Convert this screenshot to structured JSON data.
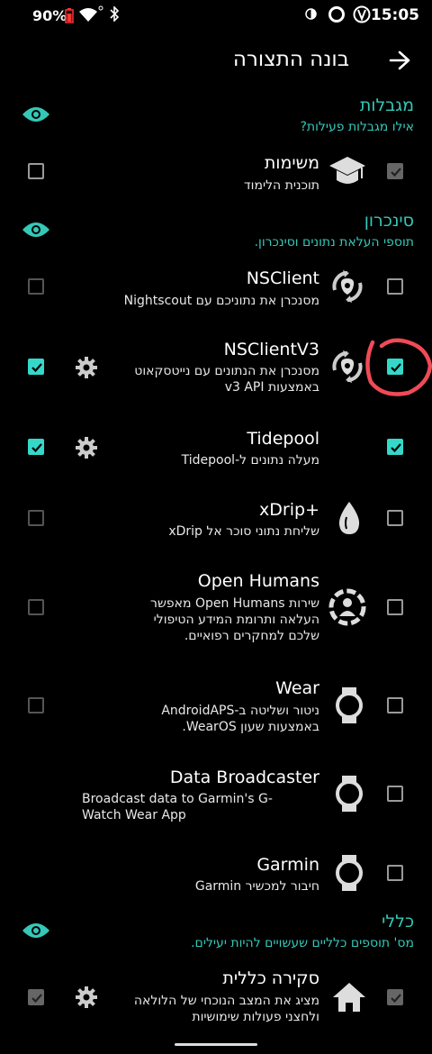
{
  "status": {
    "battery": "90%",
    "time": "15:05"
  },
  "appbar": {
    "title": "בונה התצורה"
  },
  "sections": {
    "constraints": {
      "title": "מגבלות",
      "subtitle": "אילו מגבלות פעילות?"
    },
    "sync": {
      "title": "סינכרון",
      "subtitle": "תוספי העלאת נתונים וסינכרון."
    },
    "general": {
      "title": "כללי",
      "subtitle": "מס' תוספים כלליים שעשויים להיות יעילים."
    }
  },
  "plugins": [
    {
      "title": "משימות",
      "desc": "תוכנית הלימוד",
      "icon": "graduation-cap-icon",
      "enabled": true,
      "visible": false,
      "settings": false
    },
    {
      "title": "NSClient",
      "desc": "מסנכרן את נתוניכם עם Nightscout",
      "icon": "nightscout-sync-icon",
      "enabled": false,
      "visible": false,
      "settings": false
    },
    {
      "title": "NSClientV3",
      "desc": "מסנכרן את הנתונים עם נייטסקאוט באמצעות v3 API",
      "icon": "nightscout-sync-icon",
      "enabled": true,
      "visible": true,
      "settings": true
    },
    {
      "title": "Tidepool",
      "desc": "מעלה נתונים ל-Tidepool",
      "icon": "none",
      "enabled": true,
      "visible": true,
      "settings": true
    },
    {
      "title": "xDrip+",
      "desc": "שליחת נתוני סוכר אל xDrip",
      "icon": "drop-icon",
      "enabled": false,
      "visible": false,
      "settings": false
    },
    {
      "title": "Open Humans",
      "desc": "שירות Open Humans מאפשר העלאה ותרומת המידע הטיפולי שלכם למחקרים רפואיים.",
      "icon": "open-humans-icon",
      "enabled": false,
      "visible": false,
      "settings": false
    },
    {
      "title": "Wear",
      "desc": "ניטור ושליטה ב-AndroidAPS באמצעות שעון WearOS.",
      "icon": "watch-icon",
      "enabled": false,
      "visible": false,
      "settings": false
    },
    {
      "title": "Data Broadcaster",
      "desc": "Broadcast data to Garmin's G-Watch Wear App",
      "icon": "watch-icon",
      "enabled": false,
      "visible": false,
      "settings": false
    },
    {
      "title": "Garmin",
      "desc": "חיבור למכשיר Garmin",
      "icon": "watch-icon",
      "enabled": false,
      "visible": false,
      "settings": false
    },
    {
      "title": "סקירה כללית",
      "desc": "מציג את המצב הנוכחי של הלולאה ולחצני פעולות שימושיות",
      "icon": "home-icon",
      "enabled": true,
      "visible": true,
      "settings": true
    }
  ]
}
